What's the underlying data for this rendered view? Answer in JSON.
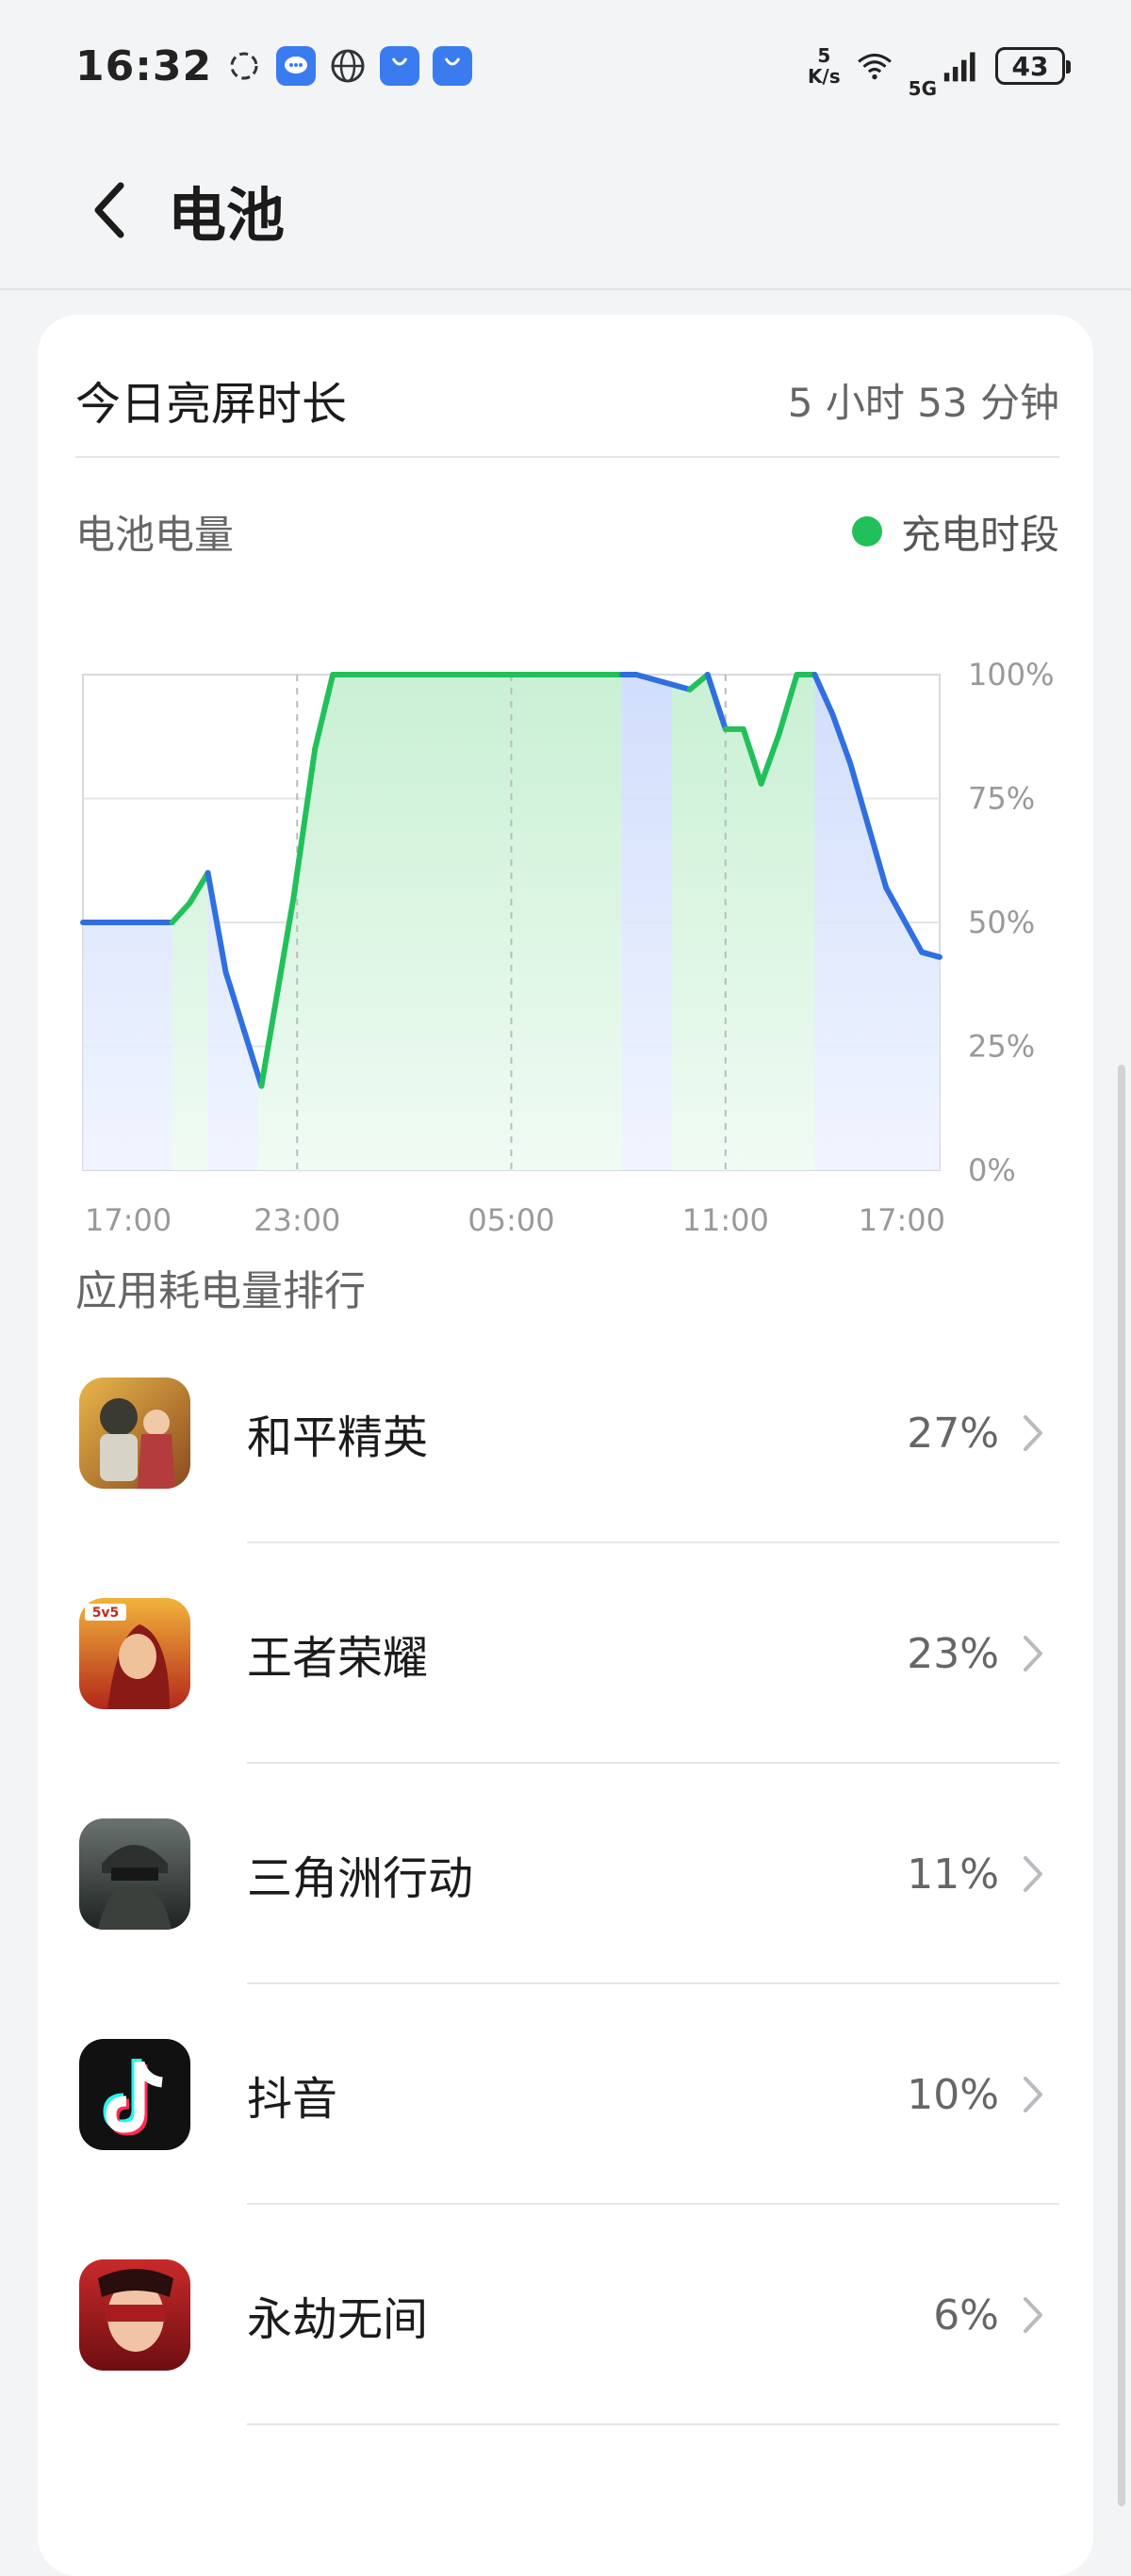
{
  "status_bar": {
    "time": "16:32",
    "net_speed_value": "5",
    "net_speed_unit": "K/s",
    "network_type": "5G",
    "battery_level": "43"
  },
  "header": {
    "title": "电池"
  },
  "screen_time": {
    "label": "今日亮屏时长",
    "value": "5 小时 53 分钟"
  },
  "battery": {
    "label": "电池电量",
    "legend_label": "充电时段",
    "charging_color": "#22c05a",
    "discharge_color": "#2f6fe0"
  },
  "chart_data": {
    "type": "area",
    "x_tick_labels": [
      "17:00",
      "23:00",
      "05:00",
      "11:00",
      "17:00"
    ],
    "y_tick_labels": [
      "100%",
      "75%",
      "50%",
      "25%",
      "0%"
    ],
    "ylim": [
      0,
      100
    ],
    "x_unit": "hours since 17:00 (previous day)",
    "points": [
      {
        "x": 0,
        "y": 50,
        "charging": false
      },
      {
        "x": 2.5,
        "y": 50,
        "charging": true
      },
      {
        "x": 3.0,
        "y": 54,
        "charging": true
      },
      {
        "x": 3.5,
        "y": 60,
        "charging": false
      },
      {
        "x": 4.0,
        "y": 40,
        "charging": false
      },
      {
        "x": 5.0,
        "y": 17,
        "charging": true
      },
      {
        "x": 5.9,
        "y": 55,
        "charging": true
      },
      {
        "x": 6.5,
        "y": 85,
        "charging": true
      },
      {
        "x": 7.0,
        "y": 100,
        "charging": true
      },
      {
        "x": 15.1,
        "y": 100,
        "charging": false
      },
      {
        "x": 15.5,
        "y": 100,
        "charging": false
      },
      {
        "x": 17.0,
        "y": 97,
        "charging": true
      },
      {
        "x": 17.5,
        "y": 100,
        "charging": false
      },
      {
        "x": 18.0,
        "y": 89,
        "charging": true
      },
      {
        "x": 18.5,
        "y": 89,
        "charging": true
      },
      {
        "x": 19.0,
        "y": 78,
        "charging": true
      },
      {
        "x": 19.5,
        "y": 88,
        "charging": true
      },
      {
        "x": 20.0,
        "y": 100,
        "charging": true
      },
      {
        "x": 20.5,
        "y": 100,
        "charging": false
      },
      {
        "x": 21.0,
        "y": 92,
        "charging": false
      },
      {
        "x": 21.5,
        "y": 82,
        "charging": false
      },
      {
        "x": 22.5,
        "y": 57,
        "charging": false
      },
      {
        "x": 23.5,
        "y": 44,
        "charging": false
      },
      {
        "x": 24.0,
        "y": 43,
        "charging": false
      }
    ],
    "charging_periods": [
      [
        2.5,
        3.5
      ],
      [
        4.9,
        15.1
      ],
      [
        16.5,
        18.5
      ],
      [
        18.5,
        20.5
      ]
    ]
  },
  "ranking": {
    "title": "应用耗电量排行",
    "apps": [
      {
        "name": "和平精英",
        "percent": "27%",
        "icon": "pubg-mobile-icon"
      },
      {
        "name": "王者荣耀",
        "percent": "23%",
        "icon": "honor-of-kings-icon"
      },
      {
        "name": "三角洲行动",
        "percent": "11%",
        "icon": "delta-force-icon"
      },
      {
        "name": "抖音",
        "percent": "10%",
        "icon": "douyin-icon"
      },
      {
        "name": "永劫无间",
        "percent": "6%",
        "icon": "naraka-icon"
      }
    ]
  }
}
